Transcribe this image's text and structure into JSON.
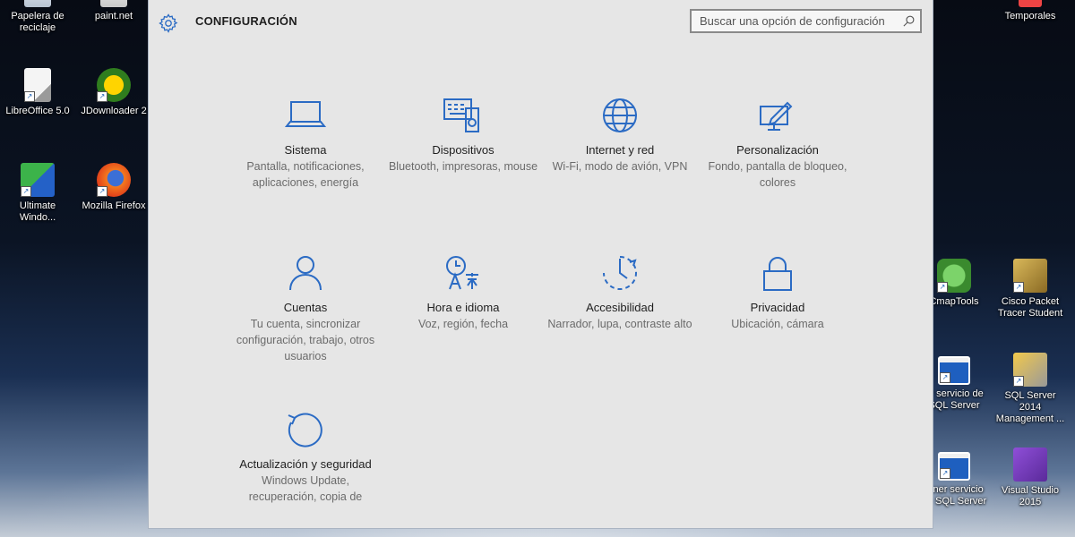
{
  "desktop": {
    "icons": [
      {
        "label": "Papelera de reciclaje"
      },
      {
        "label": "paint.net"
      },
      {
        "label": "LibreOffice 5.0"
      },
      {
        "label": "JDownloader 2"
      },
      {
        "label": "Ultimate Windo..."
      },
      {
        "label": "Mozilla Firefox"
      },
      {
        "label": "Temporales"
      },
      {
        "label": "CmapTools"
      },
      {
        "label": "Cisco Packet Tracer Student"
      },
      {
        "label": "ar servicio de SQL Server"
      },
      {
        "label": "SQL Server 2014 Management ..."
      },
      {
        "label": "tener servicio de SQL Server"
      },
      {
        "label": "Visual Studio 2015"
      }
    ]
  },
  "window": {
    "title": "CONFIGURACIÓN",
    "search_placeholder": "Buscar una opción de configuración",
    "accent": "#2b6bc4",
    "tiles": [
      {
        "title": "Sistema",
        "desc": "Pantalla, notificaciones, aplicaciones, energía",
        "icon": "laptop-icon"
      },
      {
        "title": "Dispositivos",
        "desc": "Bluetooth, impresoras, mouse",
        "icon": "devices-icon"
      },
      {
        "title": "Internet y red",
        "desc": "Wi-Fi, modo de avión, VPN",
        "icon": "globe-icon"
      },
      {
        "title": "Personalización",
        "desc": "Fondo, pantalla de bloqueo, colores",
        "icon": "paint-icon"
      },
      {
        "title": "Cuentas",
        "desc": "Tu cuenta, sincronizar configuración, trabajo, otros usuarios",
        "icon": "person-icon"
      },
      {
        "title": "Hora e idioma",
        "desc": "Voz, región, fecha",
        "icon": "time-language-icon"
      },
      {
        "title": "Accesibilidad",
        "desc": "Narrador, lupa, contraste alto",
        "icon": "ease-of-access-icon"
      },
      {
        "title": "Privacidad",
        "desc": "Ubicación, cámara",
        "icon": "lock-icon"
      },
      {
        "title": "Actualización y seguridad",
        "desc": "Windows Update, recuperación, copia de",
        "icon": "update-icon"
      }
    ]
  }
}
